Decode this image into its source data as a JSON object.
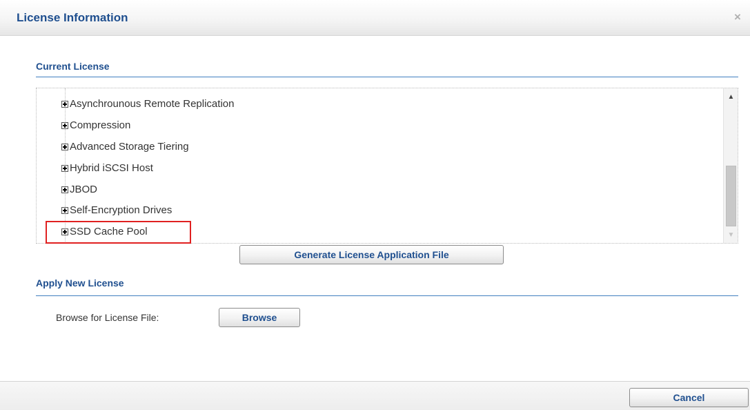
{
  "dialog": {
    "title": "License Information",
    "close_glyph": "×"
  },
  "current_license": {
    "section_title": "Current License",
    "items": [
      {
        "label": "Asynchrounous Remote Replication",
        "expander": "plus"
      },
      {
        "label": "Compression",
        "expander": "plus"
      },
      {
        "label": "Advanced Storage Tiering",
        "expander": "plus"
      },
      {
        "label": "Hybrid iSCSI Host",
        "expander": "plus"
      },
      {
        "label": "JBOD",
        "expander": "plus"
      },
      {
        "label": "Self-Encryption Drives",
        "expander": "plus"
      },
      {
        "label": "SSD Cache Pool",
        "expander": "plus",
        "highlighted": true
      }
    ],
    "generate_button": "Generate License Application File"
  },
  "apply_new_license": {
    "section_title": "Apply New License",
    "browse_label": "Browse for License File:",
    "browse_button": "Browse"
  },
  "footer": {
    "cancel_button": "Cancel"
  },
  "colors": {
    "accent": "#1f4f8f",
    "highlight_border": "#e02020",
    "section_rule": "#3f7fbf"
  }
}
